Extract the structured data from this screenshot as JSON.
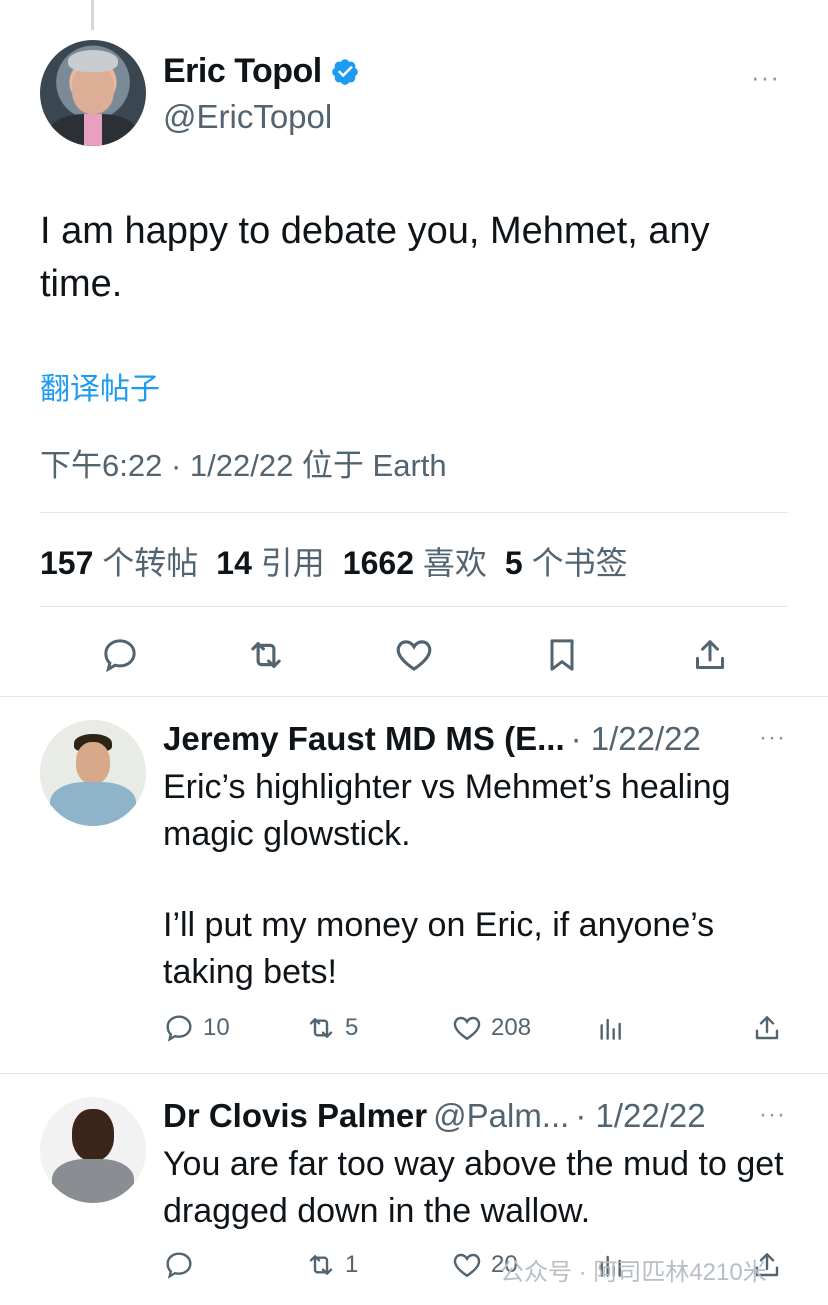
{
  "main_tweet": {
    "display_name": "Eric Topol",
    "handle": "@EricTopol",
    "text": "I am happy to debate you, Mehmet, any time.",
    "translate_label": "翻译帖子",
    "meta": "下午6:22 · 1/22/22 位于 Earth",
    "stats": [
      {
        "count": "157",
        "label": "个转帖"
      },
      {
        "count": "14",
        "label": "引用"
      },
      {
        "count": "1662",
        "label": "喜欢"
      },
      {
        "count": "5",
        "label": "个书签"
      }
    ],
    "more_label": "···"
  },
  "replies": [
    {
      "display_name": "Jeremy Faust MD MS (E...",
      "handle": "",
      "date": "· 1/22/22",
      "more_label": "···",
      "text_1": "Eric’s highlighter vs Mehmet’s healing magic glowstick.",
      "text_2": "I’ll put my money on Eric, if anyone’s taking bets!",
      "replies_count": "10",
      "retweets_count": "5",
      "likes_count": "208"
    },
    {
      "display_name": "Dr Clovis Palmer",
      "handle": "@Palm...",
      "date": "· 1/22/22",
      "more_label": "···",
      "text_1": "You are far too way above the mud to get dragged down in the wallow.",
      "replies_count": "",
      "retweets_count": "1",
      "likes_count": "20"
    }
  ],
  "watermark": "公众号 · 阿司匹林4210米",
  "colors": {
    "accent": "#1d9bf0",
    "secondary_text": "#536471",
    "divider": "#e1e8ed"
  }
}
